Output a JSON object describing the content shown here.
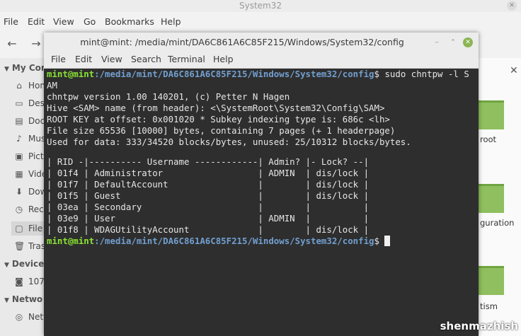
{
  "file_manager": {
    "title": "System32",
    "close_glyph": "✕",
    "menu": [
      "File",
      "Edit",
      "View",
      "Go",
      "Bookmarks",
      "Help"
    ],
    "back_glyph": "←",
    "forward_glyph": "→",
    "sidebar": {
      "my_computer": "My Com",
      "items": [
        {
          "label": "Hon",
          "icon": "home-icon",
          "glyph": "⌂"
        },
        {
          "label": "Des",
          "icon": "desktop-icon",
          "glyph": "▭"
        },
        {
          "label": "Doc",
          "icon": "documents-icon",
          "glyph": "▤"
        },
        {
          "label": "Mus",
          "icon": "music-icon",
          "glyph": "♪"
        },
        {
          "label": "Pictu",
          "icon": "pictures-icon",
          "glyph": "▣"
        },
        {
          "label": "Vide",
          "icon": "videos-icon",
          "glyph": "▦"
        },
        {
          "label": "Dow",
          "icon": "downloads-icon",
          "glyph": "⬇"
        },
        {
          "label": "Rece",
          "icon": "recent-icon",
          "glyph": "◷"
        },
        {
          "label": "File",
          "icon": "filesystem-icon",
          "glyph": "▢"
        },
        {
          "label": "Tras",
          "icon": "trash-icon",
          "glyph": "🗑"
        }
      ],
      "devices": "Devices",
      "device_items": [
        {
          "label": "107",
          "icon": "drive-icon",
          "glyph": "◙"
        }
      ],
      "network": "Netwo",
      "network_items": [
        {
          "label": "Netv",
          "icon": "network-icon",
          "glyph": "◎"
        }
      ]
    },
    "content": {
      "close_glyph": "✕",
      "labels": [
        "root",
        "guration",
        "tism"
      ]
    }
  },
  "terminal": {
    "title": "mint@mint: /media/mint/DA6C861A6C85F215/Windows/System32/config",
    "min_glyph": "‒",
    "max_glyph": "⌃",
    "close_glyph": "✕",
    "menu": [
      "File",
      "Edit",
      "View",
      "Search",
      "Terminal",
      "Help"
    ],
    "prompt_user": "mint@mint",
    "prompt_path": ":/media/mint/DA6C861A6C85F215/Windows/System32/config",
    "prompt_symbol": "$",
    "command": " sudo chntpw -l S",
    "command_wrap": "AM",
    "output": [
      "chntpw version 1.00 140201, (c) Petter N Hagen",
      "Hive <SAM> name (from header): <\\SystemRoot\\System32\\Config\\SAM>",
      "ROOT KEY at offset: 0x001020 * Subkey indexing type is: 686c <lh>",
      "File size 65536 [10000] bytes, containing 7 pages (+ 1 headerpage)",
      "Used for data: 333/34520 blocks/bytes, unused: 25/10312 blocks/bytes."
    ],
    "table_header": "| RID -|---------- Username ------------| Admin? |- Lock? --|",
    "table_rows": [
      "| 01f4 | Administrator                  | ADMIN  | dis/lock |",
      "| 01f7 | DefaultAccount                 |        | dis/lock |",
      "| 01f5 | Guest                          |        | dis/lock |",
      "| 03ea | Secondary                      |        |          |",
      "| 03e9 | User                           | ADMIN  |          |",
      "| 01f8 | WDAGUtilityAccount             |        | dis/lock |"
    ]
  },
  "watermark": "shenmazhish"
}
